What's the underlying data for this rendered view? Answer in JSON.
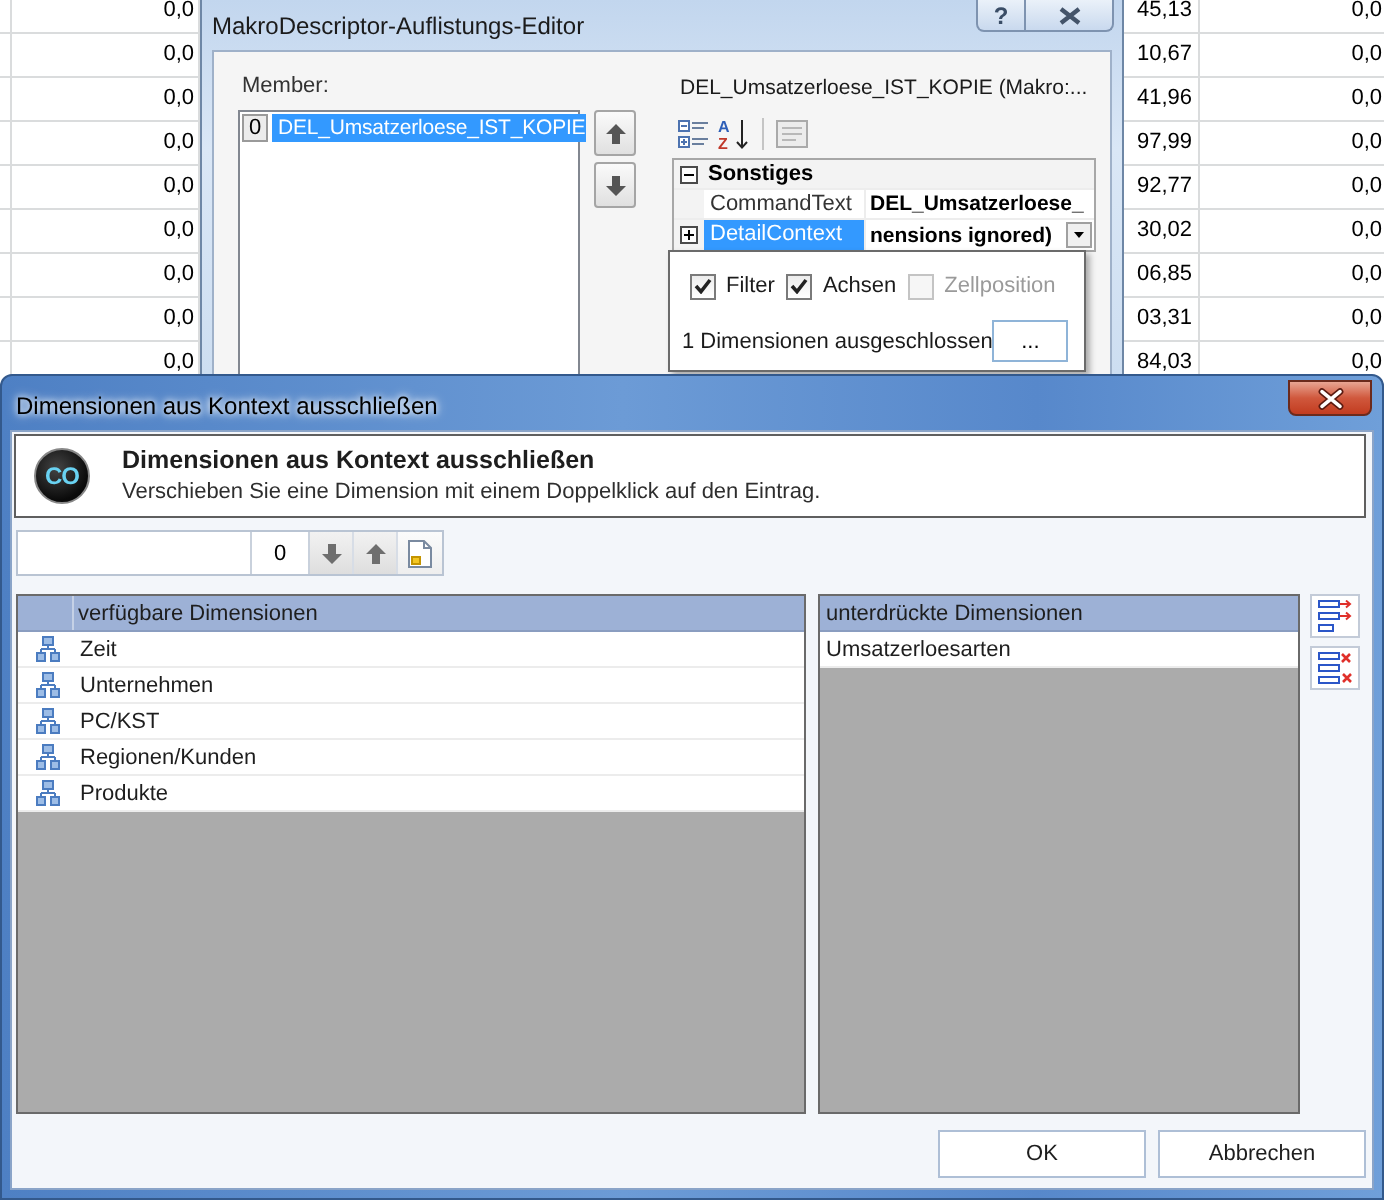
{
  "spreadsheet": {
    "rows": [
      {
        "column_1": "0,0",
        "column_2": "45,13",
        "column_3": "0,0"
      },
      {
        "column_1": "0,0",
        "column_2": "10,67",
        "column_3": "0,0"
      },
      {
        "column_1": "0,0",
        "column_2": "41,96",
        "column_3": "0,0"
      },
      {
        "column_1": "0,0",
        "column_2": "97,99",
        "column_3": "0,0"
      },
      {
        "column_1": "0,0",
        "column_2": "92,77",
        "column_3": "0,0"
      },
      {
        "column_1": "0,0",
        "column_2": "30,02",
        "column_3": "0,0"
      },
      {
        "column_1": "0,0",
        "column_2": "06,85",
        "column_3": "0,0"
      },
      {
        "column_1": "0,0",
        "column_2": "03,31",
        "column_3": "0,0"
      },
      {
        "column_1": "0,0",
        "column_2": "84,03",
        "column_3": "0,0"
      }
    ]
  },
  "editor_window": {
    "title": "MakroDescriptor-Auflistungs-Editor",
    "help_button": "?",
    "member_label": "Member:",
    "members": [
      {
        "index": "0",
        "label": "DEL_Umsatzerloese_IST_KOPIE",
        "selected": true
      }
    ],
    "property_caption": "DEL_Umsatzerloese_IST_KOPIE (Makro:...",
    "sort_icon_letters": [
      "A",
      "Z"
    ],
    "category": {
      "label": "Sonstiges",
      "expanded": true
    },
    "properties": [
      {
        "kind": "text",
        "name": "CommandText",
        "value": "DEL_Umsatzerloese_",
        "selected": false
      },
      {
        "kind": "expandable",
        "name": "DetailContext",
        "value": "nensions ignored)",
        "selected": true,
        "expanded": false
      }
    ],
    "popup": {
      "options": [
        {
          "label": "Filter",
          "checked": true,
          "disabled": false
        },
        {
          "label": "Achsen",
          "checked": true,
          "disabled": false
        },
        {
          "label": "Zellposition",
          "checked": false,
          "disabled": true
        }
      ],
      "summary": "1 Dimensionen ausgeschlossen",
      "browse_button": "..."
    }
  },
  "dialog": {
    "title": "Dimensionen aus Kontext ausschließen",
    "header": {
      "logo_text": "CO",
      "title": "Dimensionen aus Kontext ausschließen",
      "subtitle": "Verschieben Sie eine Dimension mit einem Doppelklick auf den Eintrag."
    },
    "toolbar": {
      "count": "0"
    },
    "available": {
      "header": "verfügbare Dimensionen",
      "rows": [
        {
          "label": "Zeit",
          "selected": false
        },
        {
          "label": "Unternehmen",
          "selected": false
        },
        {
          "label": "PC/KST",
          "selected": false
        },
        {
          "label": "Regionen/Kunden",
          "selected": false
        },
        {
          "label": "Produkte",
          "selected": false
        }
      ]
    },
    "suppressed": {
      "header": "unterdrückte Dimensionen",
      "rows": [
        {
          "label": "Umsatzerloesarten",
          "selected": false
        }
      ]
    },
    "buttons": [
      "OK",
      "Abbrechen"
    ]
  }
}
